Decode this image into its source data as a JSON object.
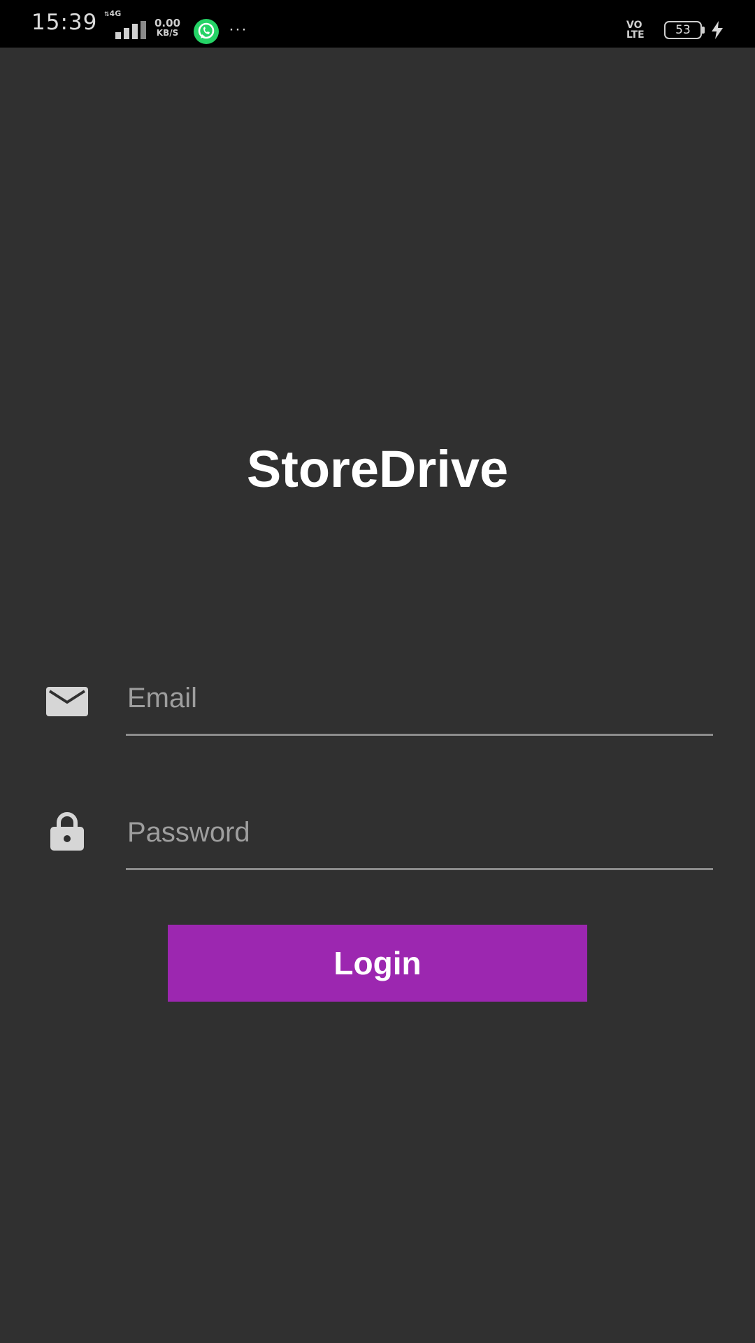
{
  "status_bar": {
    "time": "15:39",
    "network_type": "4G",
    "speed_value": "0.00",
    "speed_unit": "KB/S",
    "more": "···",
    "volte_top": "VO",
    "volte_bottom": "LTE",
    "battery_level": "53",
    "icons": [
      "signal-icon",
      "whatsapp-icon",
      "battery-icon",
      "charging-icon"
    ]
  },
  "app": {
    "title": "StoreDrive"
  },
  "form": {
    "email_placeholder": "Email",
    "email_value": "",
    "password_placeholder": "Password",
    "password_value": "",
    "login_label": "Login"
  },
  "colors": {
    "background": "#303030",
    "status_bar": "#000000",
    "accent": "#9c27b0",
    "whatsapp": "#25d366",
    "input_line": "#8c8c8c",
    "icon_gray": "#d6d6d6"
  }
}
